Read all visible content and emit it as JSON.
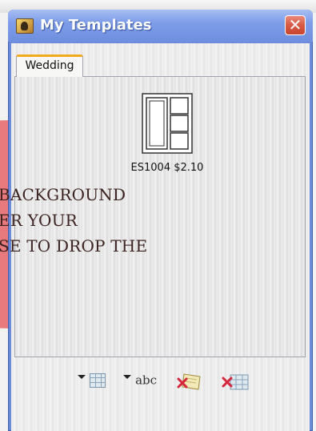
{
  "background": {
    "lines": [
      "BACKGROUND",
      "ER YOUR",
      "SE TO DROP THE"
    ],
    "ellipse_color": "#e8797c"
  },
  "window": {
    "title": "My Templates",
    "icon": "templates-app-icon",
    "close_icon": "close-x-icon",
    "close_label": "✕"
  },
  "tabs": [
    {
      "label": "Wedding",
      "selected": true
    }
  ],
  "templates": [
    {
      "code": "ES1004",
      "price": "$2.10",
      "label": "ES1004 $2.10",
      "icon": "layout-thumbnail-icon"
    }
  ],
  "toolbar": {
    "buttons": [
      {
        "name": "add-layout-dropdown",
        "icon": "dropdown-grid-icon"
      },
      {
        "name": "add-text-dropdown",
        "icon": "dropdown-text-icon",
        "label": "abc"
      },
      {
        "name": "delete-image",
        "icon": "delete-image-icon"
      },
      {
        "name": "delete-layout",
        "icon": "delete-grid-icon"
      }
    ]
  },
  "colors": {
    "titlebar": "#7e9de9",
    "close_button": "#d65a44",
    "tab_accent": "#f2a91e"
  }
}
